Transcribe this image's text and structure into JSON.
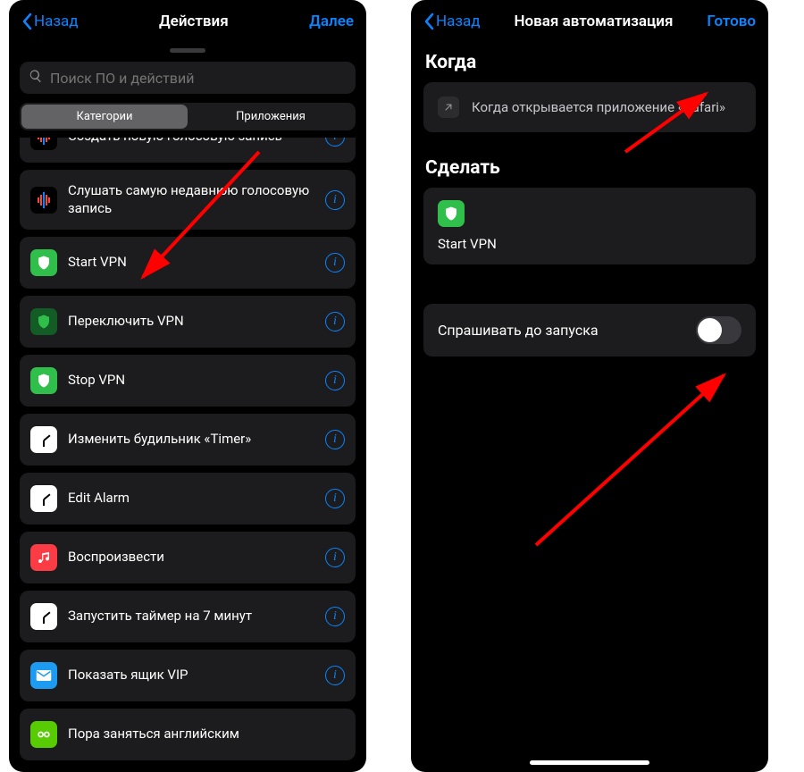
{
  "left": {
    "nav": {
      "back": "Назад",
      "title": "Действия",
      "next": "Далее"
    },
    "search": {
      "placeholder": "Поиск ПО и действий"
    },
    "seg": {
      "cat": "Категории",
      "apps": "Приложения"
    },
    "rows": [
      {
        "label": "Создать новую голосовую запись",
        "icon": "voice"
      },
      {
        "label": "Слушать самую недавнюю голосовую запись",
        "icon": "voice"
      },
      {
        "label": "Start VPN",
        "icon": "shield"
      },
      {
        "label": "Переключить VPN",
        "icon": "shield-dark"
      },
      {
        "label": "Stop VPN",
        "icon": "shield"
      },
      {
        "label": "Изменить будильник «Timer»",
        "icon": "clock"
      },
      {
        "label": "Edit Alarm",
        "icon": "clock"
      },
      {
        "label": "Воспроизвести",
        "icon": "music"
      },
      {
        "label": "Запустить таймер на 7 минут",
        "icon": "clock"
      },
      {
        "label": "Показать ящик VIP",
        "icon": "mail"
      },
      {
        "label": "Пора заняться английским",
        "icon": "duo"
      }
    ]
  },
  "right": {
    "nav": {
      "back": "Назад",
      "title": "Новая автоматизация",
      "done": "Готово"
    },
    "when": {
      "heading": "Когда",
      "text": "Когда открывается приложение «Safari»"
    },
    "do": {
      "heading": "Сделать",
      "action": "Start VPN"
    },
    "ask": {
      "label": "Спрашивать до запуска",
      "on": false
    }
  }
}
